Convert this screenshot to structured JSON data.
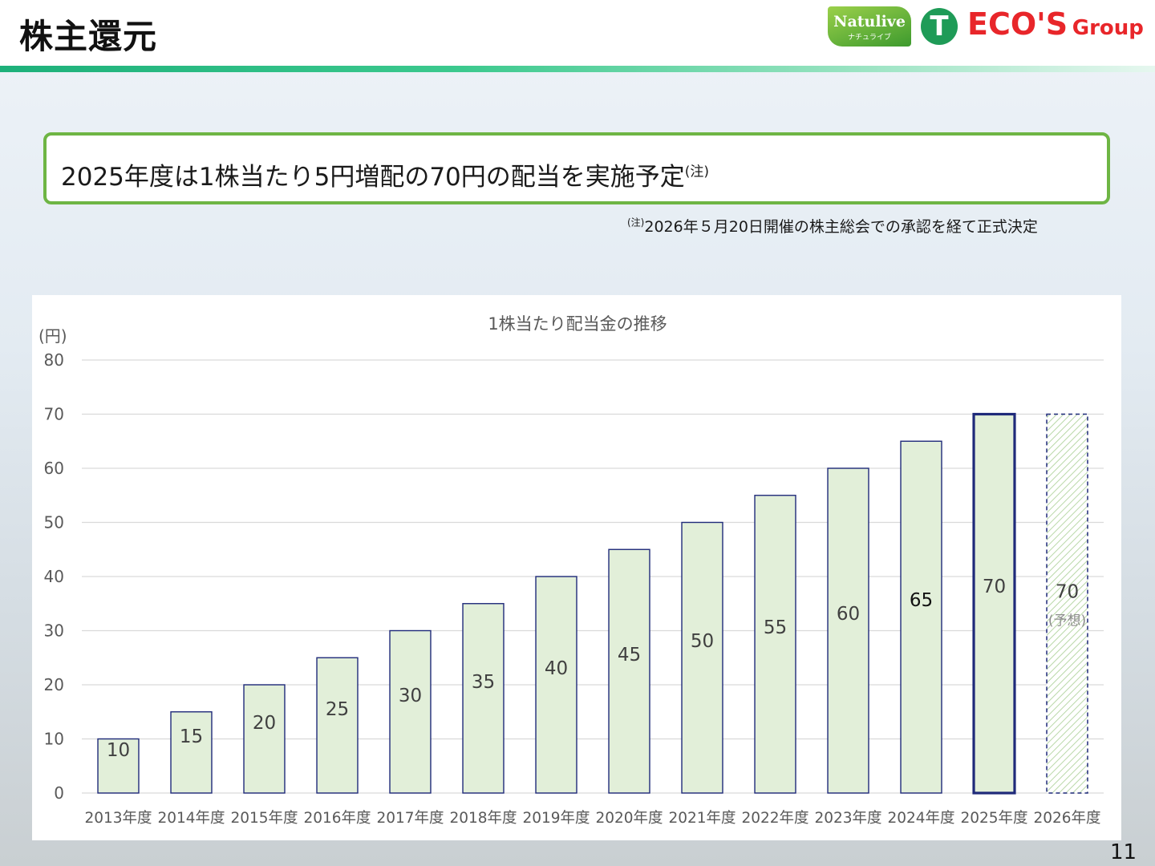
{
  "header": {
    "title": "株主還元",
    "logo_natulive": "Natulive",
    "logo_natulive_sub": "ナチュライブ",
    "logo_t": "T",
    "logo_ecos": "ECO'S",
    "logo_group": "Group"
  },
  "highlight": {
    "text": "2025年度は1株当たり5円増配の70円の配当を実施予定",
    "note_mark": "(注)"
  },
  "footnote": {
    "mark": "(注)",
    "text": "2026年５月20日開催の株主総会での承認を経て正式決定"
  },
  "chart_data": {
    "type": "bar",
    "title": "1株当たり配当金の推移",
    "ylabel": "(円)",
    "xlabel": "",
    "ylim": [
      0,
      80
    ],
    "yticks": [
      0,
      10,
      20,
      30,
      40,
      50,
      60,
      70,
      80
    ],
    "grid": true,
    "categories": [
      "2013年度",
      "2014年度",
      "2015年度",
      "2016年度",
      "2017年度",
      "2018年度",
      "2019年度",
      "2020年度",
      "2021年度",
      "2022年度",
      "2023年度",
      "2024年度",
      "2025年度",
      "2026年度"
    ],
    "values": [
      10,
      15,
      20,
      25,
      30,
      35,
      40,
      45,
      50,
      55,
      60,
      65,
      70,
      70
    ],
    "labels": [
      "10",
      "15",
      "20",
      "25",
      "30",
      "35",
      "40",
      "45",
      "50",
      "55",
      "60",
      "65",
      "70",
      "70"
    ],
    "forecast_index": 13,
    "forecast_label": "(予想)",
    "highlight_index": 12,
    "colors": {
      "bar_fill": "#e2efd9",
      "bar_stroke": "#1f2a7a",
      "forecast_stroke": "#1f2a7a",
      "forecast_hatch": "#b9d8a8",
      "grid": "#d9d9d9",
      "axis_text": "#595959"
    }
  },
  "page_number": "11"
}
